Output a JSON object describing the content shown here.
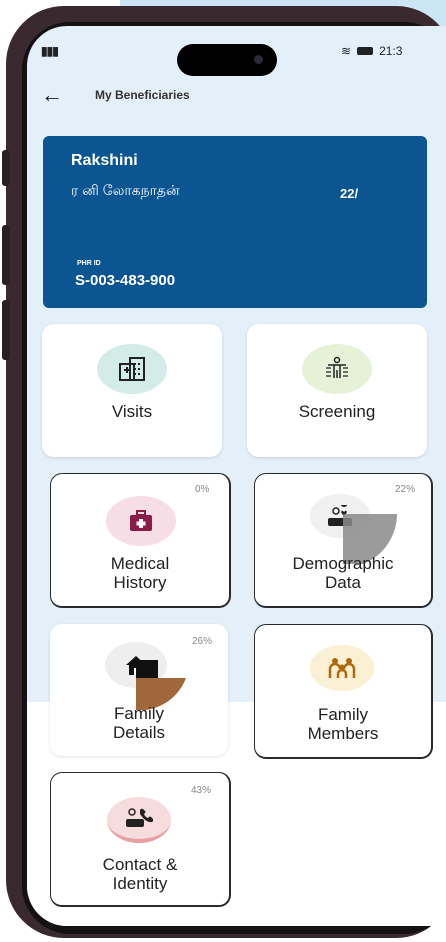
{
  "status_bar": {
    "time": "21:3"
  },
  "header": {
    "title": "My Beneficiaries"
  },
  "beneficiary": {
    "name": "Rakshini",
    "name_tamil": "ர னி லோகநாதன்",
    "age": "22/",
    "phr_label": "PHR ID",
    "phr_id": "S-003-483-900"
  },
  "tiles": {
    "visits": {
      "label": "Visits",
      "icon": "hospital-icon"
    },
    "screening": {
      "label": "Screening",
      "icon": "body-scan-icon"
    },
    "medical_history": {
      "line1": "Medical",
      "line2": "History",
      "percent": "0%",
      "icon": "first-aid-kit-icon"
    },
    "demographic_data": {
      "line1": "Demographic",
      "line2": "Data",
      "percent": "22%",
      "icon": "person-location-icon"
    },
    "family_details": {
      "line1": "Family",
      "line2": "Details",
      "percent": "26%",
      "icon": "house-icon"
    },
    "family_members": {
      "line1": "Family",
      "line2": "Members",
      "icon": "family-icon"
    },
    "contact_identity": {
      "line1": "Contact &",
      "line2": "Identity",
      "percent": "43%",
      "icon": "contact-phone-icon"
    }
  },
  "colors": {
    "card_blue": "#0b5592",
    "screen_bg": "#e3f0f9",
    "visits_icon_bg": "#d3ece8",
    "screening_icon_bg": "#e6f2d8",
    "medical_icon_bg": "#f7dde6",
    "family_members_icon_bg": "#fbf0d4",
    "contact_icon_bg": "#f6dcdc"
  }
}
